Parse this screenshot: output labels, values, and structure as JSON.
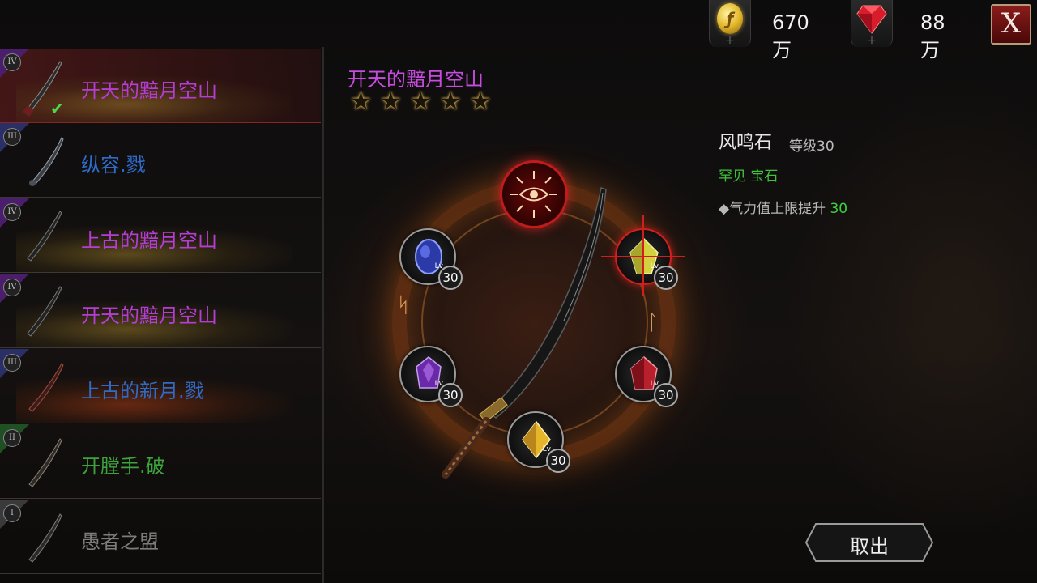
{
  "currency": {
    "coin": {
      "icon": "gold-coin-icon",
      "value": "670万"
    },
    "gem": {
      "icon": "ruby-icon",
      "value": "88万"
    },
    "close_label": "X"
  },
  "weapon_list": [
    {
      "rank": "IV",
      "name": "开天的黯月空山",
      "color": "#b53dd6",
      "selected": true
    },
    {
      "rank": "III",
      "name": "纵容.戮",
      "color": "#2f6bc9",
      "selected": false
    },
    {
      "rank": "IV",
      "name": "上古的黯月空山",
      "color": "#b53dd6",
      "selected": false
    },
    {
      "rank": "IV",
      "name": "开天的黯月空山",
      "color": "#b53dd6",
      "selected": false
    },
    {
      "rank": "III",
      "name": "上古的新月.戮",
      "color": "#2f6bc9",
      "selected": false
    },
    {
      "rank": "II",
      "name": "开膛手.破",
      "color": "#3da33d",
      "selected": false
    },
    {
      "rank": "I",
      "name": "愚者之盟",
      "color": "#7c7c7c",
      "selected": false
    }
  ],
  "detail": {
    "weapon_name": "开天的黯月空山",
    "stars": 5,
    "star_glyph": "★"
  },
  "sockets": [
    {
      "id": "eye",
      "icon": "eye-sigil-icon"
    },
    {
      "id": "top-left",
      "icon": "blue-gem-icon",
      "lv": "Lv",
      "level": "30",
      "color": "#3b4fc8"
    },
    {
      "id": "top-right",
      "icon": "yellow-green-gem-icon",
      "lv": "Lv",
      "level": "30",
      "color": "#d8d64a",
      "selected": true
    },
    {
      "id": "mid-left",
      "icon": "purple-gem-icon",
      "lv": "Lv",
      "level": "30",
      "color": "#7a36b8"
    },
    {
      "id": "mid-right",
      "icon": "red-gem-icon",
      "lv": "Lv",
      "level": "30",
      "color": "#c8303c"
    },
    {
      "id": "bottom",
      "icon": "gold-gem-icon",
      "lv": "Lv",
      "level": "30",
      "color": "#e8b830"
    }
  ],
  "runes": [
    "ᛋ",
    "ᛚ"
  ],
  "gem_info": {
    "name": "风鸣石",
    "level": "等级30",
    "rarity": "罕见 宝石",
    "stat_label": "◆气力值上限提升",
    "stat_value": "30"
  },
  "actions": {
    "take_out": "取出"
  }
}
